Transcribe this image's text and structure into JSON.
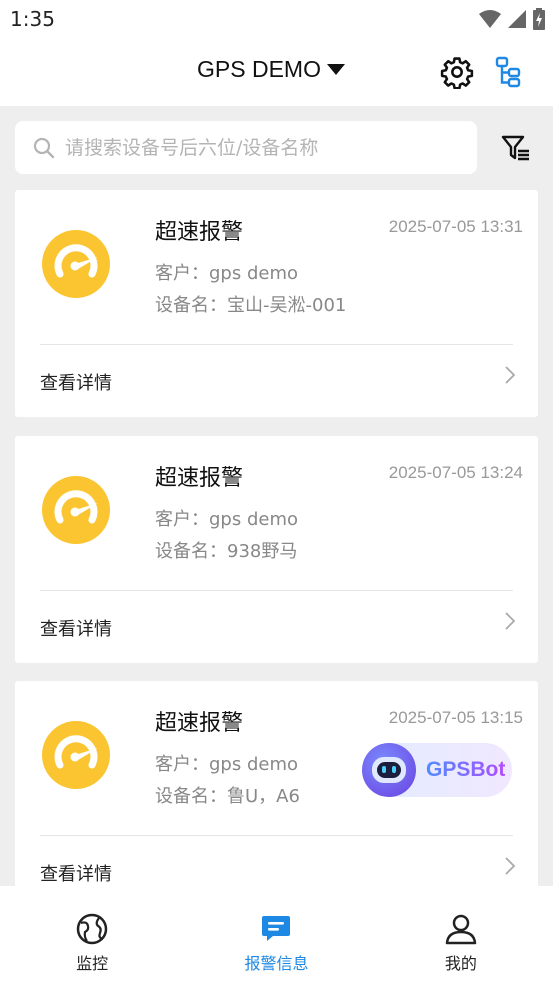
{
  "status_bar": {
    "time": "1:35"
  },
  "header": {
    "title": "GPS DEMO"
  },
  "search": {
    "placeholder": "请搜索设备号后六位/设备名称"
  },
  "alerts": [
    {
      "title": "超速报警",
      "time": "2025-07-05 13:31",
      "customer": "客户：gps demo",
      "device": "设备名：宝山-吴淞-001",
      "details_label": "查看详情"
    },
    {
      "title": "超速报警",
      "time": "2025-07-05 13:24",
      "customer": "客户：gps demo",
      "device": "设备名：938野马",
      "details_label": "查看详情"
    },
    {
      "title": "超速报警",
      "time": "2025-07-05 13:15",
      "customer": "客户：gps demo",
      "device": "设备名：鲁U，A6",
      "details_label": "查看详情"
    }
  ],
  "bot": {
    "label": "GPSBot"
  },
  "bottom_nav": [
    {
      "label": "监控",
      "icon": "globe-icon",
      "active": false
    },
    {
      "label": "报警信息",
      "icon": "message-icon",
      "active": true
    },
    {
      "label": "我的",
      "icon": "person-icon",
      "active": false
    }
  ],
  "colors": {
    "accent": "#1e88e5",
    "alert_icon": "#fbc531",
    "background": "#eeeeee"
  }
}
